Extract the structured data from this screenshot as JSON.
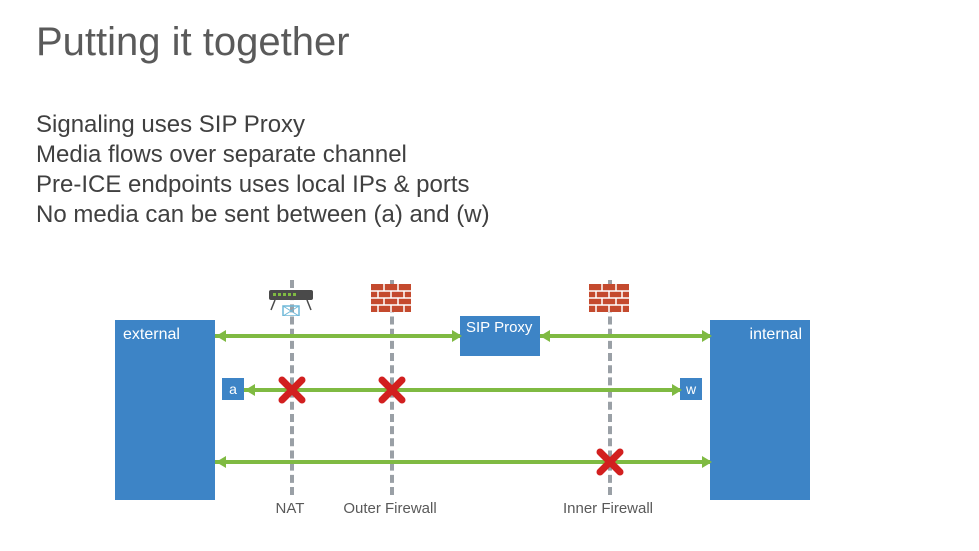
{
  "title": "Putting it together",
  "bullets": {
    "l1": "Signaling uses SIP Proxy",
    "l2": "Media flows over separate channel",
    "l3": "Pre-ICE endpoints uses local IPs & ports",
    "l4": "No media can be sent between (a) and (w)"
  },
  "diagram": {
    "external": "external",
    "internal": "internal",
    "sip": "SIP Proxy",
    "a": "a",
    "w": "w",
    "nat": "NAT",
    "outer": "Outer Firewall",
    "inner": "Inner Firewall"
  },
  "colors": {
    "blue": "#3d84c6",
    "green": "#7fba42",
    "brick": "#c44a2e",
    "red": "#d21f1f"
  }
}
